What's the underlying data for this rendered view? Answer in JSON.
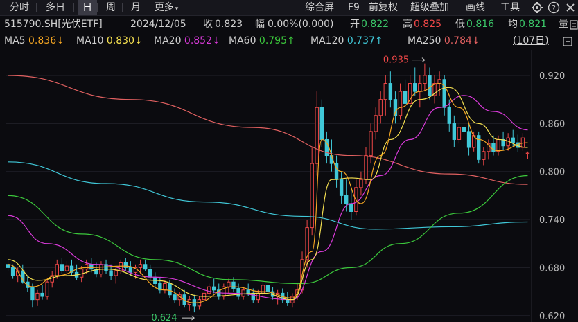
{
  "toolbar": {
    "tabs": [
      {
        "label": "分时",
        "selected": false
      },
      {
        "label": "多日",
        "selected": false
      },
      {
        "label": "日",
        "selected": true
      },
      {
        "label": "周",
        "selected": false
      },
      {
        "label": "月",
        "selected": false
      },
      {
        "label": "更多",
        "selected": false,
        "has_dropdown": true
      }
    ],
    "tools": [
      "综合屏",
      "F9",
      "前复权",
      "超级叠加",
      "画线",
      "工具"
    ],
    "icons": [
      "gear-icon",
      "help-icon",
      "close-icon"
    ]
  },
  "info": {
    "symbol": "515790.SH[光伏ETF]",
    "date": "2024/12/05",
    "close_label": "收",
    "close": "0.823",
    "change_label": "幅",
    "change": "0.00%(0.000)",
    "open_label": "开",
    "open": "0.822",
    "high_label": "高",
    "high": "0.825",
    "low_label": "低",
    "low": "0.816",
    "avg_label": "均",
    "avg": "0.821",
    "vol_label": "量",
    "vol_icon": "vol-icon"
  },
  "ma_legend": [
    {
      "name": "MA5",
      "value": "0.836↓",
      "color": "#f5a623"
    },
    {
      "name": "MA10",
      "value": "0.830↓",
      "color": "#f5e050"
    },
    {
      "name": "MA20",
      "value": "0.852↓",
      "color": "#d83ad8"
    },
    {
      "name": "MA60",
      "value": "0.795↑",
      "color": "#3cc93c"
    },
    {
      "name": "MA120",
      "value": "0.737↑",
      "color": "#40c8d8"
    },
    {
      "name": "MA250",
      "value": "0.784↓",
      "color": "#e06060"
    }
  ],
  "period_count": "(107日)",
  "chart_data": {
    "type": "candlestick",
    "y_ticks": [
      "0.920",
      "0.860",
      "0.800",
      "0.740",
      "0.680",
      "0.620"
    ],
    "ylim": [
      0.612,
      0.952
    ],
    "candle_count": 107,
    "annotations": {
      "max": "0.935",
      "min": "0.624"
    },
    "colors": {
      "up": "#f04848",
      "down": "#40c8d8",
      "grid": "#202028"
    },
    "candles": [
      [
        0.684,
        0.69,
        0.676,
        0.68
      ],
      [
        0.68,
        0.684,
        0.666,
        0.67
      ],
      [
        0.67,
        0.68,
        0.662,
        0.676
      ],
      [
        0.676,
        0.684,
        0.66,
        0.662
      ],
      [
        0.662,
        0.67,
        0.65,
        0.655
      ],
      [
        0.655,
        0.66,
        0.63,
        0.64
      ],
      [
        0.64,
        0.652,
        0.632,
        0.648
      ],
      [
        0.648,
        0.658,
        0.64,
        0.644
      ],
      [
        0.644,
        0.666,
        0.64,
        0.662
      ],
      [
        0.662,
        0.676,
        0.655,
        0.67
      ],
      [
        0.67,
        0.69,
        0.666,
        0.684
      ],
      [
        0.684,
        0.692,
        0.672,
        0.676
      ],
      [
        0.676,
        0.688,
        0.668,
        0.682
      ],
      [
        0.682,
        0.69,
        0.67,
        0.674
      ],
      [
        0.674,
        0.684,
        0.664,
        0.668
      ],
      [
        0.668,
        0.682,
        0.662,
        0.678
      ],
      [
        0.678,
        0.69,
        0.672,
        0.684
      ],
      [
        0.684,
        0.692,
        0.674,
        0.678
      ],
      [
        0.678,
        0.686,
        0.668,
        0.672
      ],
      [
        0.672,
        0.688,
        0.668,
        0.684
      ],
      [
        0.684,
        0.69,
        0.672,
        0.676
      ],
      [
        0.676,
        0.684,
        0.664,
        0.67
      ],
      [
        0.67,
        0.68,
        0.66,
        0.676
      ],
      [
        0.676,
        0.69,
        0.672,
        0.686
      ],
      [
        0.686,
        0.692,
        0.676,
        0.68
      ],
      [
        0.68,
        0.688,
        0.67,
        0.674
      ],
      [
        0.674,
        0.684,
        0.666,
        0.68
      ],
      [
        0.68,
        0.69,
        0.672,
        0.684
      ],
      [
        0.684,
        0.69,
        0.676,
        0.678
      ],
      [
        0.678,
        0.684,
        0.664,
        0.668
      ],
      [
        0.668,
        0.674,
        0.656,
        0.66
      ],
      [
        0.66,
        0.668,
        0.648,
        0.652
      ],
      [
        0.652,
        0.664,
        0.648,
        0.66
      ],
      [
        0.66,
        0.664,
        0.642,
        0.646
      ],
      [
        0.646,
        0.654,
        0.636,
        0.64
      ],
      [
        0.64,
        0.65,
        0.632,
        0.646
      ],
      [
        0.646,
        0.652,
        0.63,
        0.634
      ],
      [
        0.634,
        0.644,
        0.626,
        0.64
      ],
      [
        0.64,
        0.646,
        0.624,
        0.632
      ],
      [
        0.632,
        0.644,
        0.628,
        0.64
      ],
      [
        0.64,
        0.652,
        0.636,
        0.648
      ],
      [
        0.648,
        0.66,
        0.644,
        0.656
      ],
      [
        0.656,
        0.666,
        0.648,
        0.652
      ],
      [
        0.652,
        0.66,
        0.64,
        0.644
      ],
      [
        0.644,
        0.66,
        0.64,
        0.656
      ],
      [
        0.656,
        0.666,
        0.648,
        0.662
      ],
      [
        0.662,
        0.668,
        0.65,
        0.654
      ],
      [
        0.654,
        0.66,
        0.64,
        0.644
      ],
      [
        0.644,
        0.656,
        0.64,
        0.652
      ],
      [
        0.652,
        0.66,
        0.644,
        0.648
      ],
      [
        0.648,
        0.654,
        0.636,
        0.64
      ],
      [
        0.64,
        0.652,
        0.636,
        0.648
      ],
      [
        0.648,
        0.662,
        0.644,
        0.658
      ],
      [
        0.658,
        0.664,
        0.646,
        0.65
      ],
      [
        0.65,
        0.656,
        0.64,
        0.644
      ],
      [
        0.644,
        0.652,
        0.634,
        0.648
      ],
      [
        0.648,
        0.654,
        0.636,
        0.64
      ],
      [
        0.64,
        0.65,
        0.632,
        0.636
      ],
      [
        0.636,
        0.648,
        0.63,
        0.644
      ],
      [
        0.644,
        0.66,
        0.64,
        0.652
      ],
      [
        0.652,
        0.7,
        0.648,
        0.69
      ],
      [
        0.69,
        0.74,
        0.68,
        0.73
      ],
      [
        0.73,
        0.83,
        0.72,
        0.81
      ],
      [
        0.81,
        0.9,
        0.795,
        0.88
      ],
      [
        0.88,
        0.89,
        0.83,
        0.84
      ],
      [
        0.84,
        0.85,
        0.81,
        0.82
      ],
      [
        0.82,
        0.84,
        0.8,
        0.81
      ],
      [
        0.81,
        0.82,
        0.78,
        0.79
      ],
      [
        0.79,
        0.8,
        0.76,
        0.77
      ],
      [
        0.77,
        0.79,
        0.75,
        0.76
      ],
      [
        0.76,
        0.78,
        0.74,
        0.75
      ],
      [
        0.75,
        0.79,
        0.745,
        0.78
      ],
      [
        0.78,
        0.8,
        0.77,
        0.79
      ],
      [
        0.79,
        0.83,
        0.785,
        0.82
      ],
      [
        0.82,
        0.86,
        0.81,
        0.85
      ],
      [
        0.85,
        0.88,
        0.84,
        0.87
      ],
      [
        0.87,
        0.9,
        0.86,
        0.89
      ],
      [
        0.89,
        0.92,
        0.87,
        0.91
      ],
      [
        0.91,
        0.925,
        0.88,
        0.89
      ],
      [
        0.89,
        0.9,
        0.86,
        0.87
      ],
      [
        0.87,
        0.91,
        0.865,
        0.9
      ],
      [
        0.9,
        0.915,
        0.88,
        0.885
      ],
      [
        0.885,
        0.92,
        0.88,
        0.91
      ],
      [
        0.91,
        0.93,
        0.895,
        0.9
      ],
      [
        0.9,
        0.92,
        0.88,
        0.91
      ],
      [
        0.91,
        0.935,
        0.9,
        0.92
      ],
      [
        0.92,
        0.93,
        0.89,
        0.895
      ],
      [
        0.895,
        0.92,
        0.885,
        0.91
      ],
      [
        0.91,
        0.925,
        0.895,
        0.915
      ],
      [
        0.915,
        0.92,
        0.87,
        0.88
      ],
      [
        0.88,
        0.89,
        0.85,
        0.86
      ],
      [
        0.86,
        0.87,
        0.83,
        0.84
      ],
      [
        0.84,
        0.86,
        0.835,
        0.855
      ],
      [
        0.855,
        0.87,
        0.84,
        0.85
      ],
      [
        0.85,
        0.86,
        0.82,
        0.83
      ],
      [
        0.83,
        0.85,
        0.825,
        0.845
      ],
      [
        0.845,
        0.85,
        0.81,
        0.815
      ],
      [
        0.815,
        0.83,
        0.808,
        0.825
      ],
      [
        0.825,
        0.84,
        0.815,
        0.835
      ],
      [
        0.835,
        0.845,
        0.82,
        0.825
      ],
      [
        0.825,
        0.845,
        0.82,
        0.84
      ],
      [
        0.84,
        0.85,
        0.826,
        0.832
      ],
      [
        0.832,
        0.848,
        0.826,
        0.842
      ],
      [
        0.842,
        0.852,
        0.83,
        0.836
      ],
      [
        0.836,
        0.846,
        0.824,
        0.83
      ],
      [
        0.83,
        0.848,
        0.826,
        0.842
      ],
      [
        0.822,
        0.825,
        0.816,
        0.823
      ]
    ],
    "ma_lines": [
      {
        "name": "MA250",
        "color": "#e06060",
        "points": [
          [
            0,
            0.92
          ],
          [
            25,
            0.89
          ],
          [
            50,
            0.855
          ],
          [
            70,
            0.82
          ],
          [
            90,
            0.797
          ],
          [
            106,
            0.784
          ]
        ]
      },
      {
        "name": "MA120",
        "color": "#40c8d8",
        "points": [
          [
            0,
            0.812
          ],
          [
            20,
            0.785
          ],
          [
            40,
            0.762
          ],
          [
            60,
            0.744
          ],
          [
            75,
            0.728
          ],
          [
            90,
            0.731
          ],
          [
            106,
            0.737
          ]
        ]
      },
      {
        "name": "MA60",
        "color": "#3cc93c",
        "points": [
          [
            0,
            0.77
          ],
          [
            15,
            0.722
          ],
          [
            30,
            0.69
          ],
          [
            45,
            0.665
          ],
          [
            60,
            0.66
          ],
          [
            70,
            0.68
          ],
          [
            80,
            0.71
          ],
          [
            92,
            0.748
          ],
          [
            106,
            0.795
          ]
        ]
      },
      {
        "name": "MA20",
        "color": "#d83ad8",
        "points": [
          [
            0,
            0.745
          ],
          [
            8,
            0.71
          ],
          [
            18,
            0.684
          ],
          [
            30,
            0.668
          ],
          [
            45,
            0.648
          ],
          [
            58,
            0.64
          ],
          [
            64,
            0.7
          ],
          [
            70,
            0.76
          ],
          [
            76,
            0.795
          ],
          [
            82,
            0.84
          ],
          [
            88,
            0.88
          ],
          [
            93,
            0.895
          ],
          [
            99,
            0.875
          ],
          [
            106,
            0.852
          ]
        ]
      },
      {
        "name": "MA10",
        "color": "#f5e050",
        "points": [
          [
            0,
            0.69
          ],
          [
            6,
            0.664
          ],
          [
            12,
            0.67
          ],
          [
            20,
            0.678
          ],
          [
            30,
            0.664
          ],
          [
            40,
            0.644
          ],
          [
            52,
            0.648
          ],
          [
            58,
            0.64
          ],
          [
            62,
            0.69
          ],
          [
            66,
            0.79
          ],
          [
            70,
            0.792
          ],
          [
            74,
            0.79
          ],
          [
            78,
            0.84
          ],
          [
            84,
            0.89
          ],
          [
            90,
            0.905
          ],
          [
            96,
            0.86
          ],
          [
            100,
            0.84
          ],
          [
            106,
            0.83
          ]
        ]
      },
      {
        "name": "MA5",
        "color": "#f5a623",
        "points": [
          [
            0,
            0.684
          ],
          [
            5,
            0.656
          ],
          [
            10,
            0.67
          ],
          [
            16,
            0.68
          ],
          [
            24,
            0.682
          ],
          [
            32,
            0.652
          ],
          [
            38,
            0.636
          ],
          [
            46,
            0.656
          ],
          [
            52,
            0.65
          ],
          [
            58,
            0.642
          ],
          [
            62,
            0.7
          ],
          [
            64,
            0.84
          ],
          [
            68,
            0.8
          ],
          [
            72,
            0.76
          ],
          [
            76,
            0.82
          ],
          [
            80,
            0.88
          ],
          [
            84,
            0.9
          ],
          [
            88,
            0.91
          ],
          [
            92,
            0.88
          ],
          [
            96,
            0.84
          ],
          [
            100,
            0.826
          ],
          [
            106,
            0.836
          ]
        ]
      }
    ]
  }
}
